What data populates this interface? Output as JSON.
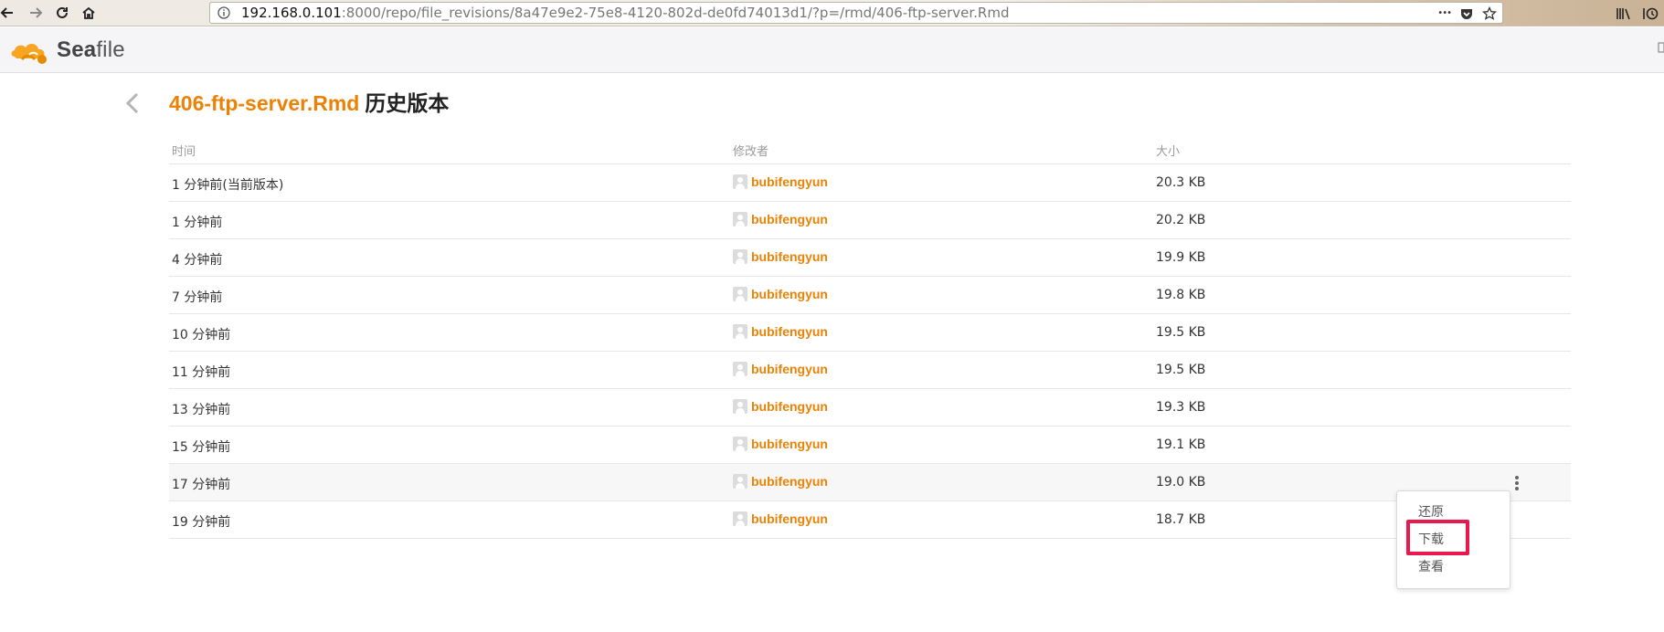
{
  "browser": {
    "url_host": "192.168.0.101",
    "url_rest": ":8000/repo/file_revisions/8a47e9e2-75e8-4120-802d-de0fd74013d1/?p=/rmd/406-ftp-server.Rmd",
    "url_more": "•••"
  },
  "app": {
    "logo_bold": "Sea",
    "logo_rest": "file"
  },
  "page": {
    "file_name": "406-ftp-server.Rmd",
    "title_suffix": "历史版本"
  },
  "table": {
    "headers": {
      "time": "时间",
      "modifier": "修改者",
      "size": "大小"
    },
    "rows": [
      {
        "time": "1 分钟前(当前版本)",
        "user": "bubifengyun",
        "size": "20.3 KB"
      },
      {
        "time": "1 分钟前",
        "user": "bubifengyun",
        "size": "20.2 KB"
      },
      {
        "time": "4 分钟前",
        "user": "bubifengyun",
        "size": "19.9 KB"
      },
      {
        "time": "7 分钟前",
        "user": "bubifengyun",
        "size": "19.8 KB"
      },
      {
        "time": "10 分钟前",
        "user": "bubifengyun",
        "size": "19.5 KB"
      },
      {
        "time": "11 分钟前",
        "user": "bubifengyun",
        "size": "19.5 KB"
      },
      {
        "time": "13 分钟前",
        "user": "bubifengyun",
        "size": "19.3 KB"
      },
      {
        "time": "15 分钟前",
        "user": "bubifengyun",
        "size": "19.1 KB"
      },
      {
        "time": "17 分钟前",
        "user": "bubifengyun",
        "size": "19.0 KB"
      },
      {
        "time": "19 分钟前",
        "user": "bubifengyun",
        "size": "18.7 KB"
      }
    ]
  },
  "dropdown": {
    "restore": "还原",
    "download": "下载",
    "view": "查看"
  },
  "colors": {
    "accent": "#eb8205",
    "highlight": "#e8194f"
  }
}
